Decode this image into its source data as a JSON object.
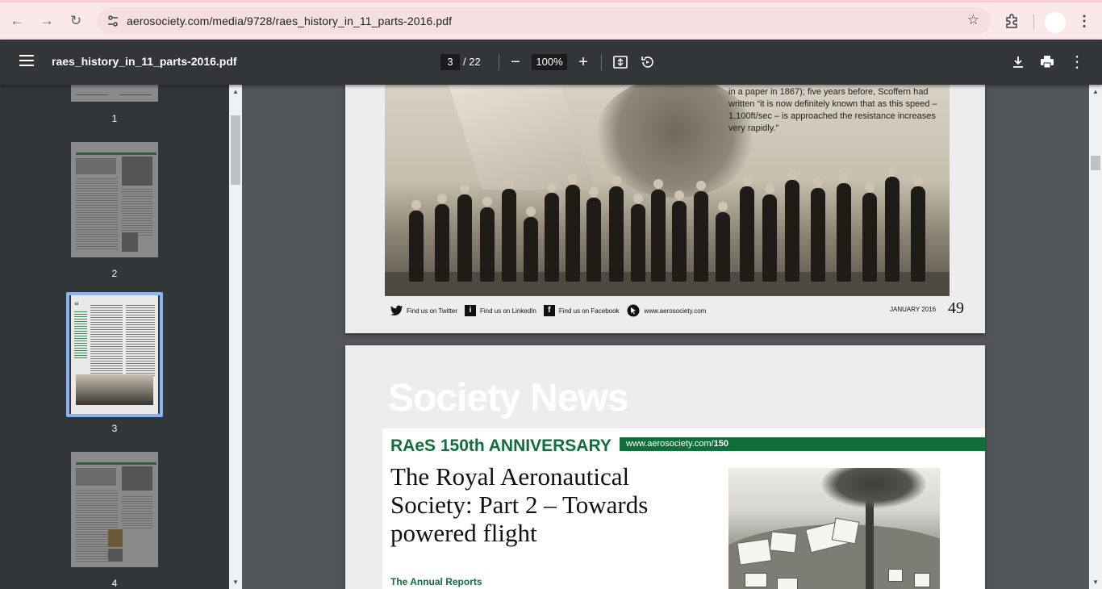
{
  "browser": {
    "url": "aerosociety.com/media/9728/raes_history_in_11_parts-2016.pdf",
    "icons": [
      "back-icon",
      "forward-icon",
      "reload-icon",
      "site-info-icon",
      "star-icon",
      "extensions-icon",
      "more-icon"
    ]
  },
  "viewer": {
    "doc_title": "raes_history_in_11_parts-2016.pdf",
    "current_page": "3",
    "total_pages": "/ 22",
    "zoom": "100%"
  },
  "thumbnails": [
    {
      "label": "1"
    },
    {
      "label": "2"
    },
    {
      "label": "3",
      "selected": true
    },
    {
      "label": "4"
    }
  ],
  "page_top": {
    "caption": "in a paper in 1867); five years before, Scoffern had written “it is now definitely known that as this speed – 1,100ft/sec – is approached the resistance increases very rapidly.”",
    "footer": {
      "twitter": "Find us on Twitter",
      "linkedin": "Find us on LinkedIn",
      "facebook": "Find us on Facebook",
      "website": "www.aerosociety.com",
      "date": "JANUARY 2016",
      "page_number": "49"
    }
  },
  "page_bottom": {
    "banner": "Society News",
    "anniversary": "RAeS 150th ANNIVERSARY",
    "link_prefix": "www.aerosociety.com/",
    "link_suffix": "150",
    "title": "The Royal Aeronautical Society: Part 2 – Towards powered flight",
    "section": "The Annual Reports"
  },
  "colors": {
    "toolbar": "#323639",
    "accent_green": "#0f6e39",
    "selection": "#8ab4f8"
  }
}
